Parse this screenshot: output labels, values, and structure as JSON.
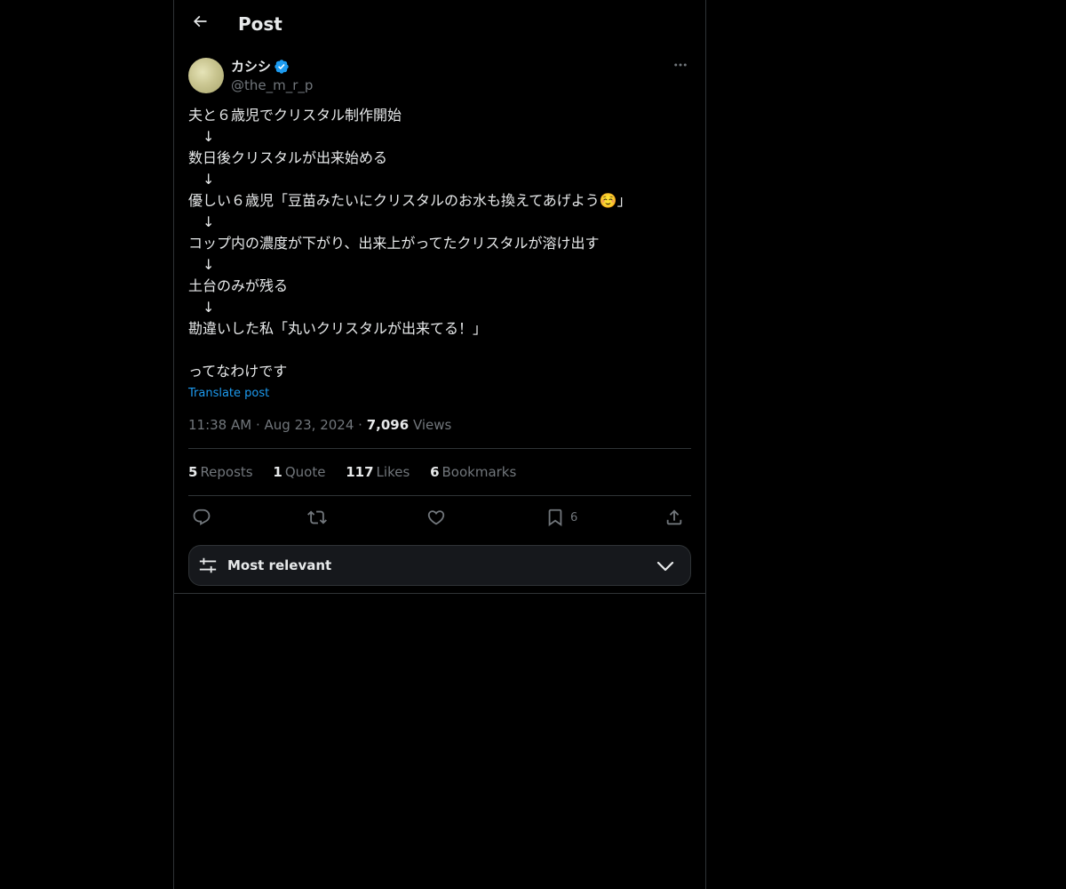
{
  "header": {
    "title": "Post"
  },
  "author": {
    "display_name": "カシシ",
    "handle": "@the_m_r_p",
    "verified": true
  },
  "post": {
    "lines": [
      "夫と６歳児でクリスタル制作開始",
      "　↓",
      "数日後クリスタルが出来始める",
      "　↓",
      "優しい６歳児「豆苗みたいにクリスタルのお水も換えてあげよう☺️」",
      "　↓",
      "コップ内の濃度が下がり、出来上がってたクリスタルが溶け出す",
      "　↓",
      "土台のみが残る",
      "　↓",
      "勘違いした私「丸いクリスタルが出来てる！」",
      "",
      "ってなわけです"
    ],
    "translate_label": "Translate post",
    "time": "11:38 AM",
    "date": "Aug 23, 2024",
    "views_count": "7,096",
    "views_label": "Views"
  },
  "stats": {
    "reposts_count": "5",
    "reposts_label": "Reposts",
    "quotes_count": "1",
    "quotes_label": "Quote",
    "likes_count": "117",
    "likes_label": "Likes",
    "bookmarks_count": "6",
    "bookmarks_label": "Bookmarks"
  },
  "actions": {
    "bookmark_count": "6"
  },
  "sort": {
    "label": "Most relevant"
  },
  "colors": {
    "background": "#000000",
    "text": "#e7e9ea",
    "muted": "#71767b",
    "link": "#1d9bf0",
    "border": "#2f3336"
  }
}
